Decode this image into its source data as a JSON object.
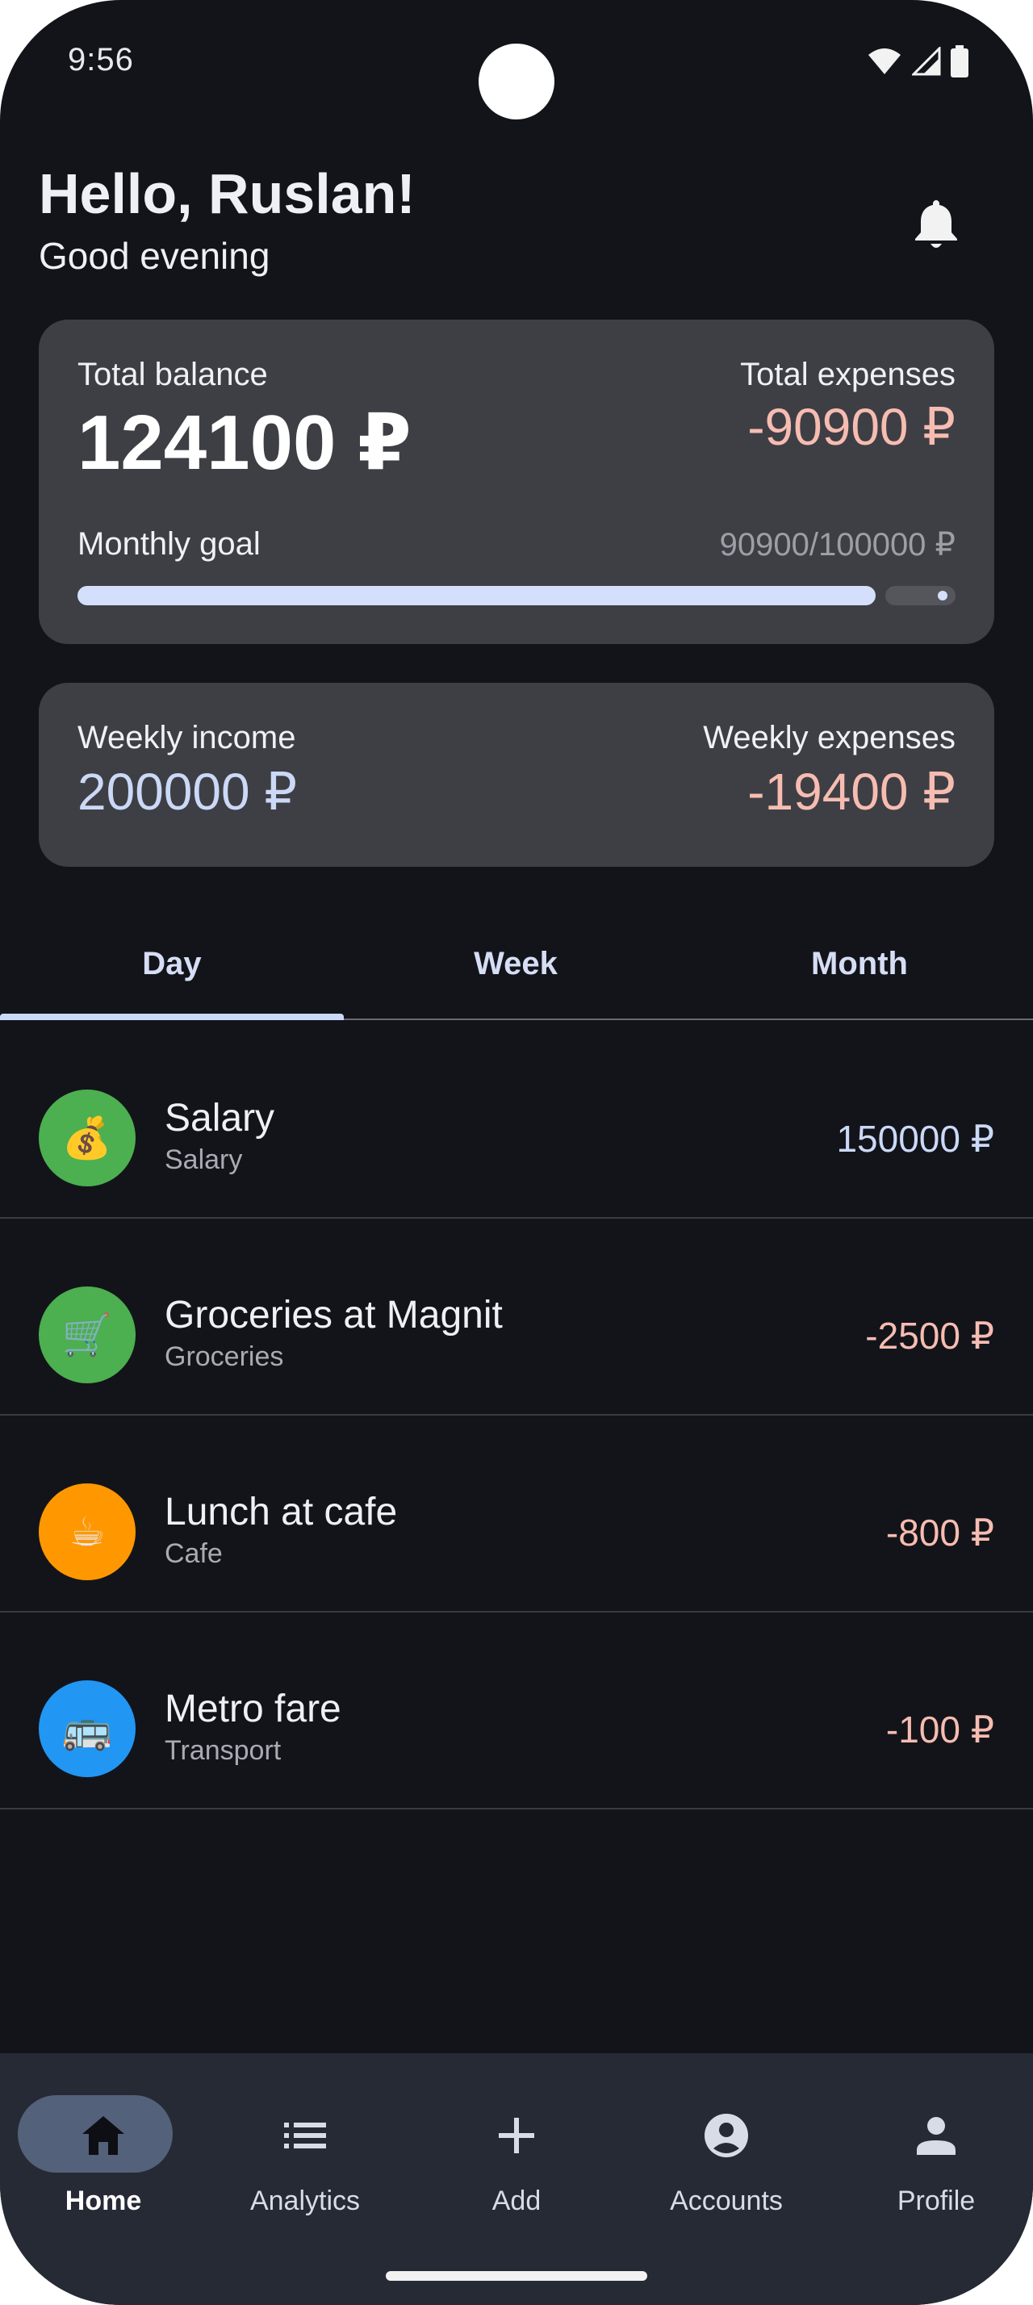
{
  "status_bar": {
    "time": "9:56",
    "icons": [
      "wifi-icon",
      "signal-icon",
      "battery-icon"
    ]
  },
  "header": {
    "greeting": "Hello, Ruslan!",
    "subtitle": "Good evening",
    "notification_icon": "bell-icon"
  },
  "balance_card": {
    "total_balance_label": "Total balance",
    "total_balance_value": "124100 ₽",
    "total_expenses_label": "Total expenses",
    "total_expenses_value": "-90900 ₽",
    "monthly_goal_label": "Monthly goal",
    "monthly_goal_progress_text": "90900/100000 ₽",
    "monthly_goal_fraction": 0.909
  },
  "weekly_card": {
    "income_label": "Weekly income",
    "income_value": "200000 ₽",
    "expenses_label": "Weekly expenses",
    "expenses_value": "-19400 ₽"
  },
  "tabs": [
    {
      "label": "Day",
      "selected": true
    },
    {
      "label": "Week",
      "selected": false
    },
    {
      "label": "Month",
      "selected": false
    }
  ],
  "transactions": [
    {
      "title": "Salary",
      "category": "Salary",
      "amount": "150000 ₽",
      "icon": "money-bag-icon",
      "emoji": "💰",
      "color": "#4caf50",
      "positive": true
    },
    {
      "title": "Groceries at Magnit",
      "category": "Groceries",
      "amount": "-2500 ₽",
      "icon": "shopping-cart-icon",
      "emoji": "🛒",
      "color": "#4caf50",
      "positive": false
    },
    {
      "title": "Lunch at cafe",
      "category": "Cafe",
      "amount": "-800 ₽",
      "icon": "coffee-icon",
      "emoji": "☕",
      "color": "#ff9800",
      "positive": false
    },
    {
      "title": "Metro fare",
      "category": "Transport",
      "amount": "-100 ₽",
      "icon": "bus-icon",
      "emoji": "🚌",
      "color": "#2196f3",
      "positive": false
    }
  ],
  "bottom_nav": [
    {
      "label": "Home",
      "icon": "home-icon",
      "active": true
    },
    {
      "label": "Analytics",
      "icon": "list-icon",
      "active": false
    },
    {
      "label": "Add",
      "icon": "plus-icon",
      "active": false
    },
    {
      "label": "Accounts",
      "icon": "account-circle-icon",
      "active": false
    },
    {
      "label": "Profile",
      "icon": "person-icon",
      "active": false
    }
  ],
  "colors": {
    "background": "#13141a",
    "card": "#3e3f45",
    "accent": "#cbd9f7",
    "negative": "#f7bcb1",
    "nav_background": "#262a35",
    "nav_active_pill": "#54617a"
  }
}
